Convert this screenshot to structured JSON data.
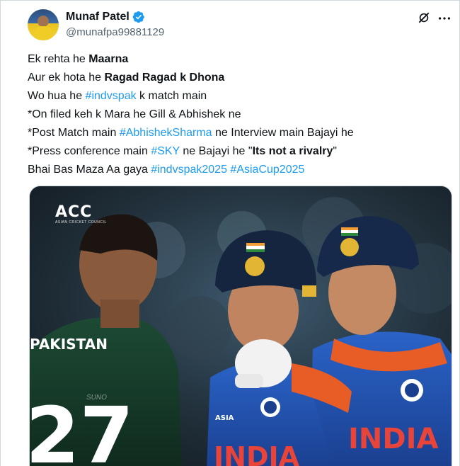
{
  "author": {
    "name": "Munaf Patel",
    "handle": "@munafpa99881129",
    "verified": true
  },
  "tweet": {
    "lines": [
      {
        "parts": [
          {
            "t": "Ek rehta he ",
            "s": "normal"
          },
          {
            "t": "Maarna",
            "s": "bold"
          }
        ]
      },
      {
        "parts": [
          {
            "t": "Aur ek hota he ",
            "s": "normal"
          },
          {
            "t": "Ragad Ragad k Dhona",
            "s": "bold"
          }
        ]
      },
      {
        "parts": [
          {
            "t": "Wo hua he ",
            "s": "normal"
          },
          {
            "t": "#indvspak",
            "s": "tag"
          },
          {
            "t": " k match main",
            "s": "normal"
          }
        ]
      },
      {
        "parts": [
          {
            "t": "*On filed keh k Mara he Gill & Abhishek ne",
            "s": "normal"
          }
        ]
      },
      {
        "parts": [
          {
            "t": "*Post Match main ",
            "s": "normal"
          },
          {
            "t": "#AbhishekSharma",
            "s": "tag"
          },
          {
            "t": " ne Interview main Bajayi he",
            "s": "normal"
          }
        ]
      },
      {
        "parts": [
          {
            "t": "*Press conference main ",
            "s": "normal"
          },
          {
            "t": "#SKY",
            "s": "tag"
          },
          {
            "t": " ne Bajayi he \"",
            "s": "normal"
          },
          {
            "t": "Its not a rivalry",
            "s": "bold"
          },
          {
            "t": "\"",
            "s": "normal"
          }
        ]
      },
      {
        "parts": [
          {
            "t": "Bhai Bas Maza Aa gaya ",
            "s": "normal"
          },
          {
            "t": "#indvspak2025",
            "s": "tag"
          },
          {
            "t": " ",
            "s": "normal"
          },
          {
            "t": "#AsiaCup2025",
            "s": "tag"
          }
        ]
      }
    ]
  },
  "media": {
    "logo": "ACC",
    "logo_sub": "ASIAN CRICKET COUNCIL",
    "watermark": "SUNO",
    "jersey_left_text": "PAKISTAN",
    "jersey_left_number": "27",
    "jersey_right_text": "INDIA",
    "jersey_mid_text": "INDIA",
    "jersey_mid_sponsor": "ASIA"
  },
  "colors": {
    "link": "#1d9bf0",
    "verified": "#1d9bf0",
    "text": "#0f1419",
    "muted": "#536471"
  },
  "icons": {
    "verified": "verified-badge-icon",
    "grok": "grok-icon",
    "more": "more-horizontal-icon"
  }
}
